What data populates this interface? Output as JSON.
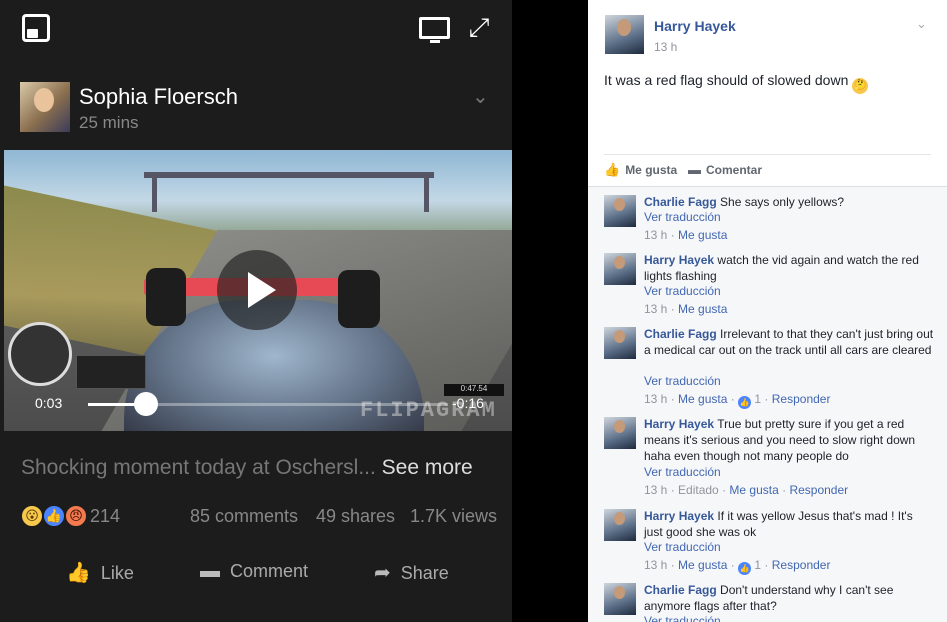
{
  "video_post": {
    "poster_name": "Sophia Floersch",
    "poster_time": "25 mins",
    "time_current": "0:03",
    "time_remaining": "-0:16",
    "progress": 0.16,
    "hud_time": "0:47.54",
    "watermark": "FLIPAGRAM",
    "caption": "Shocking moment today at Oschersl...",
    "see_more": "See more",
    "reaction_count": "214",
    "comments_count": "85 comments",
    "shares_count": "49 shares",
    "views_count": "1.7K views",
    "actions": {
      "like": "Like",
      "comment": "Comment",
      "share": "Share"
    },
    "icons": [
      "picture-in-picture-icon",
      "tv-icon",
      "expand-icon",
      "chevron-down-icon",
      "play-icon",
      "wow-icon",
      "like-icon",
      "angry-icon",
      "thumbs-up-icon",
      "comment-icon",
      "share-icon"
    ]
  },
  "original_post": {
    "author": "Harry Hayek",
    "time": "13 h",
    "text": "It was a red flag should of slowed down",
    "like_label": "Me gusta",
    "comment_label": "Comentar"
  },
  "comments": [
    {
      "author": "Charlie Fagg",
      "text": "She says only yellows?",
      "translate": "Ver traducción",
      "time": "13 h",
      "edited": "",
      "like": "Me gusta",
      "likes": "",
      "reply": ""
    },
    {
      "author": "Harry Hayek",
      "text": "watch the vid again and watch the red lights flashing",
      "translate": "Ver traducción",
      "time": "13 h",
      "edited": "",
      "like": "Me gusta",
      "likes": "",
      "reply": ""
    },
    {
      "author": "Charlie Fagg",
      "text": "Irrelevant to that they can't just bring out a medical car out on the track until all cars are cleared",
      "translate": "Ver traducción",
      "time": "13 h",
      "edited": "",
      "like": "Me gusta",
      "likes": "1",
      "reply": "Responder"
    },
    {
      "author": "Harry Hayek",
      "text": "True but pretty sure if you get a red means it's serious and you need to slow right down haha even though not many people do",
      "translate": "Ver traducción",
      "time": "13 h",
      "edited": "Editado",
      "like": "Me gusta",
      "likes": "",
      "reply": "Responder"
    },
    {
      "author": "Harry Hayek",
      "text": "If it was yellow Jesus that's mad ! It's just good she was ok",
      "translate": "Ver traducción",
      "time": "13 h",
      "edited": "",
      "like": "Me gusta",
      "likes": "1",
      "reply": "Responder"
    },
    {
      "author": "Charlie Fagg",
      "text": "Don't understand why I can't see anymore flags after that?",
      "translate": "Ver traducción",
      "time": "",
      "edited": "",
      "like": "",
      "likes": "",
      "reply": ""
    }
  ],
  "colors": {
    "link": "#365899",
    "accent": "#4267b2",
    "dark_bg": "#1c1c1c"
  }
}
